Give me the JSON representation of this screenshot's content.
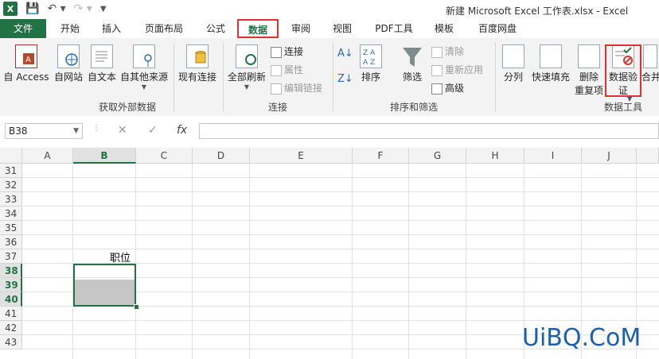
{
  "window": {
    "title": "新建 Microsoft Excel 工作表.xlsx - Excel",
    "app_icon": "X"
  },
  "qat": {
    "save_icon": "save-icon",
    "undo_icon": "undo-icon",
    "redo_icon": "redo-icon"
  },
  "tabs": [
    "文件",
    "开始",
    "插入",
    "页面布局",
    "公式",
    "数据",
    "审阅",
    "视图",
    "PDF工具",
    "模板",
    "百度网盘"
  ],
  "active_tab": "数据",
  "ribbon": {
    "get_external": {
      "buttons": [
        "自 Access",
        "自网站",
        "自文本",
        "自其他来源",
        "现有连接"
      ],
      "group_label": "获取外部数据"
    },
    "connections": {
      "refresh_all": "全部刷新",
      "connections": "连接",
      "properties": "属性",
      "edit_links": "编辑链接",
      "group_label": "连接"
    },
    "sort_filter": {
      "sort": "排序",
      "filter": "筛选",
      "clear": "清除",
      "reapply": "重新应用",
      "advanced": "高级",
      "group_label": "排序和筛选"
    },
    "data_tools": {
      "text_to_columns": "分列",
      "flash_fill": "快速填充",
      "remove_dup_line1": "删除",
      "remove_dup_line2": "重复项",
      "validation_line1": "数据验",
      "validation_line2": "证",
      "consolidate": "合并",
      "group_label": "数据工具"
    }
  },
  "formula_bar": {
    "name_box": "B38",
    "cancel": "✕",
    "enter": "✓",
    "fx": "fx",
    "value": ""
  },
  "grid": {
    "columns": [
      "A",
      "B",
      "C",
      "D",
      "E",
      "F",
      "G",
      "H",
      "I",
      "J"
    ],
    "rows": [
      "31",
      "32",
      "33",
      "34",
      "35",
      "36",
      "37",
      "38",
      "39",
      "40",
      "41",
      "42",
      "43"
    ],
    "selected_column": "B",
    "selected_rows": [
      "38",
      "39",
      "40"
    ],
    "cell_b37": "职位"
  },
  "watermark": "UiBQ.CoM",
  "colors": {
    "excel_green": "#217346",
    "highlight_red": "#e03131"
  }
}
